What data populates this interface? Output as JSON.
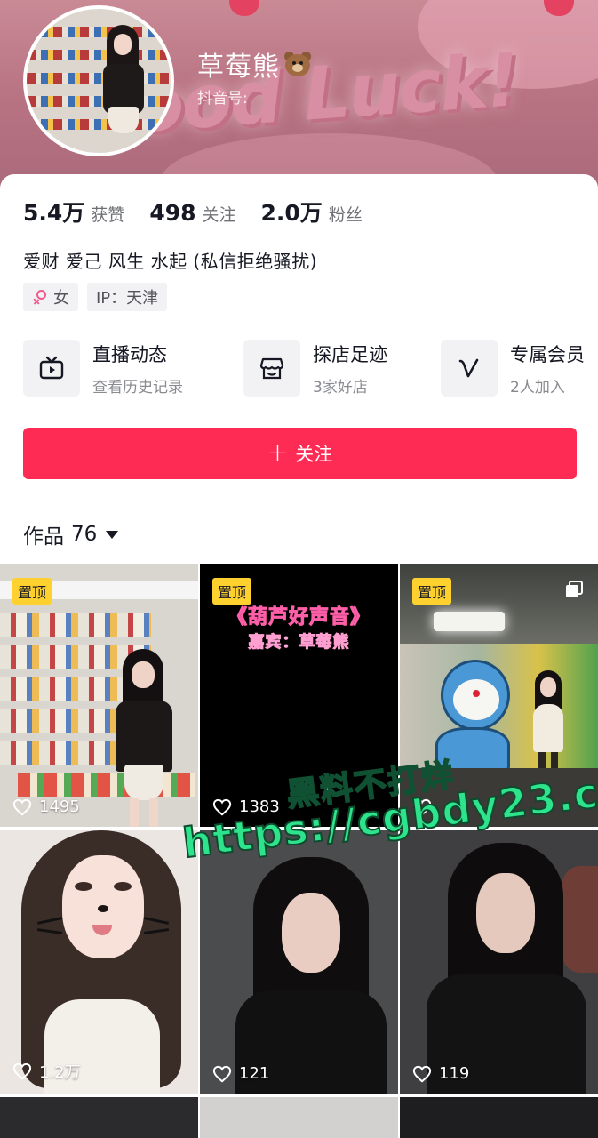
{
  "profile": {
    "name": "草莓熊",
    "douyin_id_label": "抖音号:",
    "stats": [
      {
        "num": "5.4万",
        "label": "获赞"
      },
      {
        "num": "498",
        "label": "关注"
      },
      {
        "num": "2.0万",
        "label": "粉丝"
      }
    ],
    "bio": "爱财 爱己 风生 水起 (私信拒绝骚扰)",
    "tags": {
      "gender": "女",
      "ip": "IP：天津"
    }
  },
  "features": [
    {
      "title": "直播动态",
      "sub": "查看历史记录",
      "icon": "tv-icon"
    },
    {
      "title": "探店足迹",
      "sub": "3家好店",
      "icon": "shop-icon"
    },
    {
      "title": "专属会员",
      "sub": "2人加入",
      "icon": "v-icon"
    }
  ],
  "follow_button": {
    "label": "关注"
  },
  "works": {
    "label": "作品",
    "count": "76"
  },
  "grid": {
    "pin_label": "置顶",
    "tiles": [
      {
        "likes": "1495"
      },
      {
        "likes": "1383",
        "overlay_line1": "《葫芦好声音》",
        "overlay_line2": "嘉宾：草莓熊"
      },
      {
        "likes": ""
      },
      {
        "likes": "1.2万"
      },
      {
        "likes": "121"
      },
      {
        "likes": "119"
      }
    ]
  },
  "watermark": {
    "line1": "黑料不打烊",
    "line2": "https://cgbdy23.com"
  },
  "banner": {
    "deco_text": "ood Luck!"
  },
  "colors": {
    "accent": "#fe2c55",
    "pin_bg": "#ffd12e",
    "watermark": "#2de38b"
  }
}
